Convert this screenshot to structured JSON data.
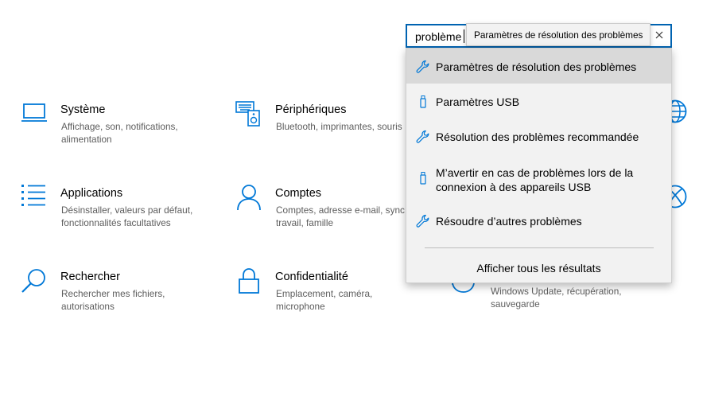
{
  "tiles": {
    "systeme": {
      "title": "Système",
      "desc": "Affichage, son, notifications, alimentation"
    },
    "peripheriques": {
      "title": "Périphériques",
      "desc": "Bluetooth, imprimantes, souris"
    },
    "applications": {
      "title": "Applications",
      "desc": "Désinstaller, valeurs par défaut, fonctionnalités facultatives"
    },
    "comptes": {
      "title": "Comptes",
      "desc": "Comptes, adresse e-mail, sync., travail, famille"
    },
    "rechercher": {
      "title": "Rechercher",
      "desc": "Rechercher mes fichiers, autorisations"
    },
    "confidentialite": {
      "title": "Confidentialité",
      "desc": "Emplacement, caméra, microphone"
    },
    "mise_a_jour": {
      "desc": "Windows Update, récupération, sauvegarde"
    }
  },
  "search": {
    "value": "problème",
    "tooltip": "Paramètres de résolution des problèmes",
    "clear_icon": "close-icon"
  },
  "results": {
    "items": [
      {
        "label": "Paramètres de résolution des problèmes",
        "icon": "wrench-icon",
        "selected": true
      },
      {
        "label": "Paramètres USB",
        "icon": "usb-icon",
        "selected": false
      },
      {
        "label": "Résolution des problèmes recommandée",
        "icon": "wrench-icon",
        "selected": false
      },
      {
        "label": "M’avertir en cas de problèmes lors de la connexion à des appareils USB",
        "icon": "usb-icon",
        "selected": false
      },
      {
        "label": "Résoudre d’autres problèmes",
        "icon": "wrench-icon",
        "selected": false
      }
    ],
    "show_all": "Afficher tous les résultats"
  },
  "colors": {
    "accent": "#0063b1",
    "icon_blue": "#0078d7",
    "dropdown_bg": "#f2f2f2",
    "selected_bg": "#d9d9d9"
  }
}
